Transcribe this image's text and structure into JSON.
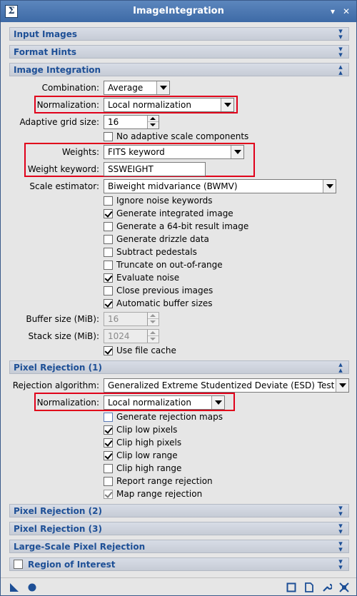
{
  "window": {
    "title": "ImageIntegration",
    "app_icon": "Σ"
  },
  "sections": {
    "input_images": "Input Images",
    "format_hints": "Format Hints",
    "image_integration": "Image Integration",
    "pixel_rejection_1": "Pixel Rejection (1)",
    "pixel_rejection_2": "Pixel Rejection (2)",
    "pixel_rejection_3": "Pixel Rejection (3)",
    "large_scale": "Large-Scale Pixel Rejection",
    "roi": "Region of Interest"
  },
  "integration": {
    "combination_label": "Combination:",
    "combination_value": "Average",
    "normalization_label": "Normalization:",
    "normalization_value": "Local normalization",
    "adaptive_label": "Adaptive grid size:",
    "adaptive_value": "16",
    "no_adaptive_label": "No adaptive scale components",
    "weights_label": "Weights:",
    "weights_value": "FITS keyword",
    "weight_keyword_label": "Weight keyword:",
    "weight_keyword_value": "SSWEIGHT",
    "scale_label": "Scale estimator:",
    "scale_value": "Biweight midvariance (BWMV)",
    "checks": {
      "ignore_noise": "Ignore noise keywords",
      "gen_integrated": "Generate integrated image",
      "gen_64bit": "Generate a 64-bit result image",
      "gen_drizzle": "Generate drizzle data",
      "subtract_pedestals": "Subtract pedestals",
      "truncate": "Truncate on out-of-range",
      "evaluate_noise": "Evaluate noise",
      "close_previous": "Close previous images",
      "auto_buffer": "Automatic buffer sizes"
    },
    "buffer_label": "Buffer size (MiB):",
    "buffer_value": "16",
    "stack_label": "Stack size (MiB):",
    "stack_value": "1024",
    "use_cache": "Use file cache"
  },
  "rejection": {
    "algorithm_label": "Rejection algorithm:",
    "algorithm_value": "Generalized Extreme Studentized Deviate (ESD) Test",
    "normalization_label": "Normalization:",
    "normalization_value": "Local normalization",
    "checks": {
      "gen_maps": "Generate rejection maps",
      "clip_low_pixels": "Clip low pixels",
      "clip_high_pixels": "Clip high pixels",
      "clip_low_range": "Clip low range",
      "clip_high_range": "Clip high range",
      "report_range": "Report range rejection",
      "map_range": "Map range rejection"
    }
  },
  "colors": {
    "accent": "#1d4f96",
    "highlight": "#e0001a",
    "titlebar": "#4a76b0"
  }
}
